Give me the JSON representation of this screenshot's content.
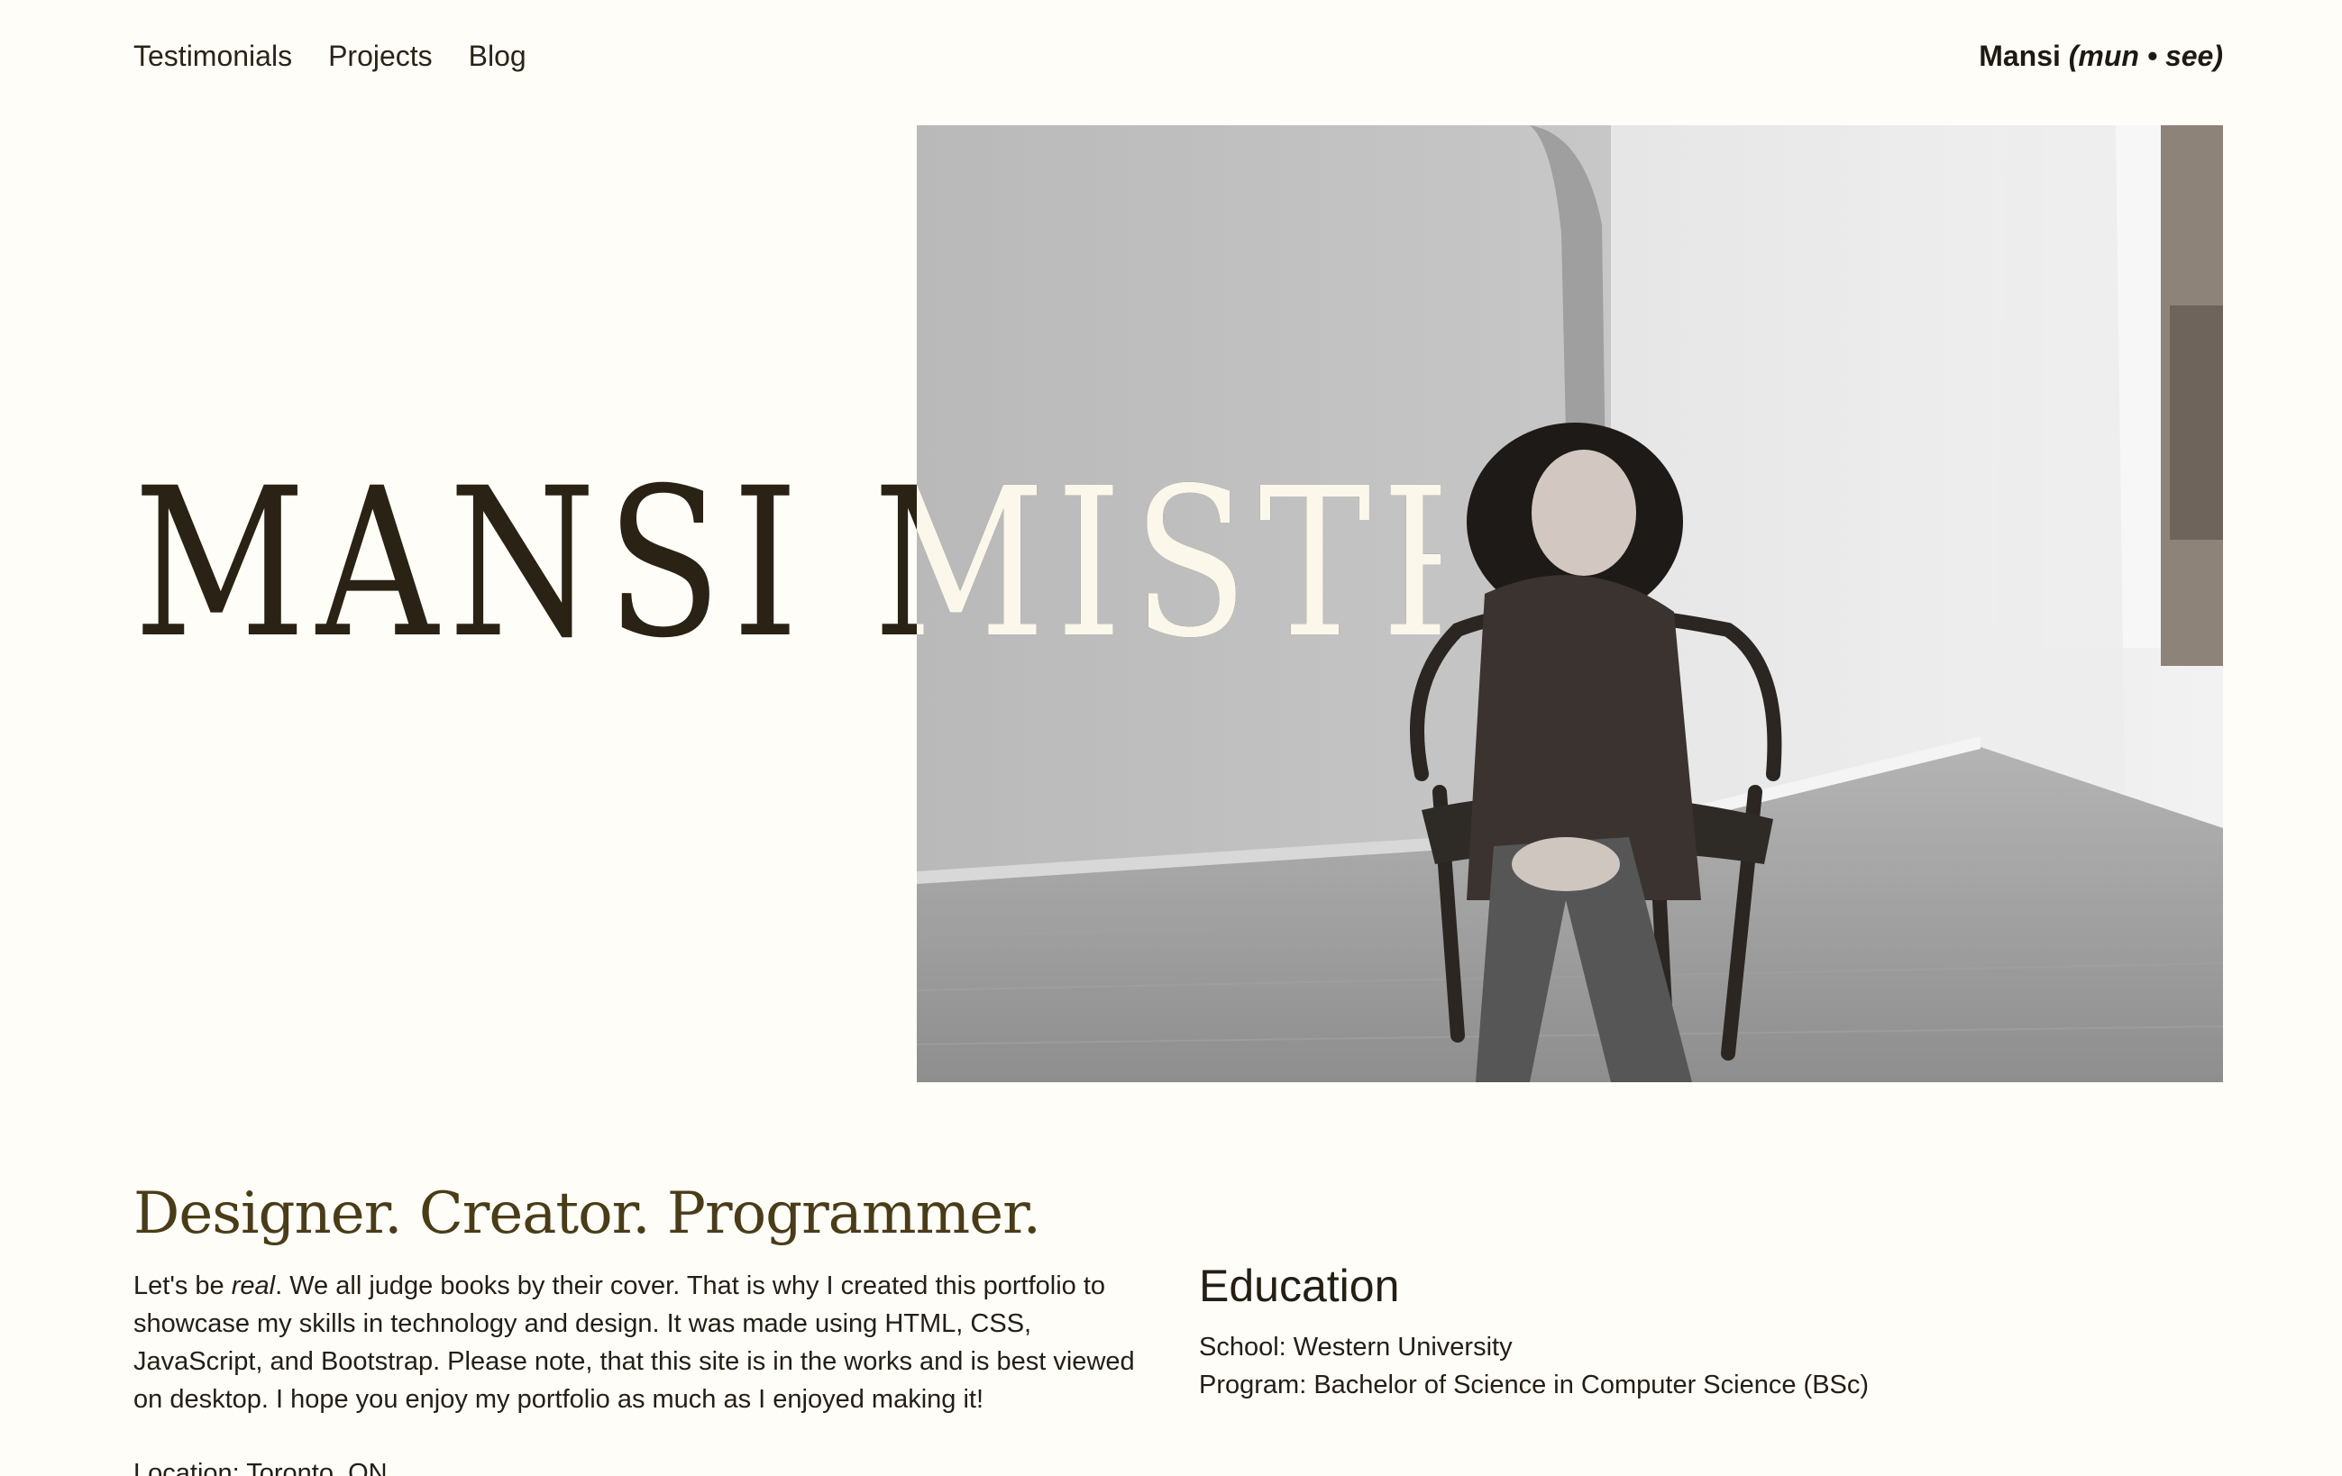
{
  "nav": {
    "items": [
      "Testimonials",
      "Projects",
      "Blog"
    ],
    "brand_name": "Mansi",
    "brand_pronunciation": "(mun • see)"
  },
  "hero": {
    "name": "MANSI MISTRY"
  },
  "about": {
    "tagline": "Designer. Creator. Programmer.",
    "intro_before": "Let's be ",
    "intro_emphasis": "real",
    "intro_after": ". We all judge books by their cover. That is why I created this portfolio to showcase my skills in technology and design. It was made using HTML, CSS, JavaScript, and Bootstrap. Please note, that this site is in the works and is best viewed on desktop. I hope you enjoy my portfolio as much as I enjoyed making it!",
    "location": "Location: Toronto, ON"
  },
  "education": {
    "title": "Education",
    "school": "School: Western University",
    "program": "Program: Bachelor of Science in Computer Science (BSc)"
  },
  "colors": {
    "background": "#fefdf8",
    "text": "#241e14",
    "tagline": "#4a3c18",
    "hero_name_dark": "#2a2214",
    "hero_name_light": "#fbf7ea"
  },
  "icons": {
    "hero_photo": "portrait-photo"
  }
}
